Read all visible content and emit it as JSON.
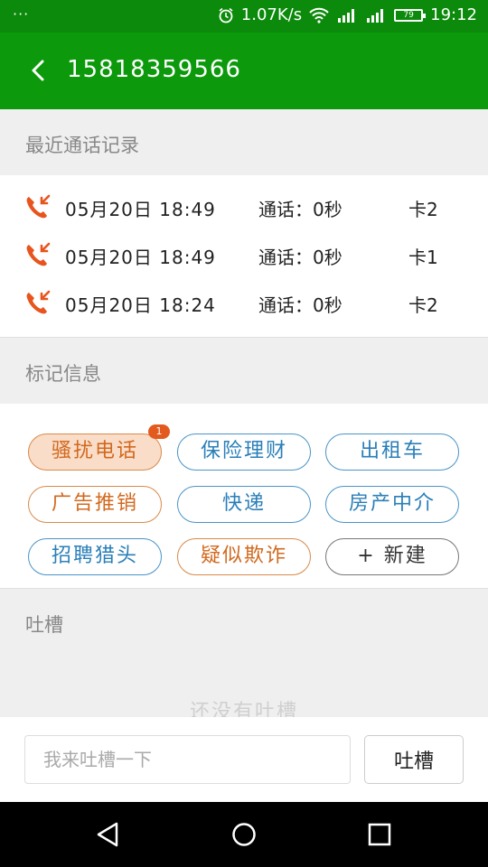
{
  "status_bar": {
    "notification_dots": "···",
    "net_speed": "1.07K/s",
    "battery": "79",
    "time": "19:12"
  },
  "app_bar": {
    "title": "15818359566",
    "back_icon": "chevron-left"
  },
  "recent_calls": {
    "header": "最近通话记录",
    "items": [
      {
        "date": "05月20日",
        "time": "18:49",
        "duration": "通话：0秒",
        "sim": "卡2"
      },
      {
        "date": "05月20日",
        "time": "18:49",
        "duration": "通话：0秒",
        "sim": "卡1"
      },
      {
        "date": "05月20日",
        "time": "18:24",
        "duration": "通话：0秒",
        "sim": "卡2"
      }
    ]
  },
  "tags": {
    "header": "标记信息",
    "items": [
      {
        "label": "骚扰电话",
        "style": "orange",
        "selected": true,
        "count": "1"
      },
      {
        "label": "保险理财",
        "style": "blue"
      },
      {
        "label": "出租车",
        "style": "blue"
      },
      {
        "label": "广告推销",
        "style": "orange"
      },
      {
        "label": "快递",
        "style": "blue"
      },
      {
        "label": "房产中介",
        "style": "blue"
      },
      {
        "label": "招聘猎头",
        "style": "blue"
      },
      {
        "label": "疑似欺诈",
        "style": "orange"
      },
      {
        "label": "+  新建",
        "style": "gray"
      }
    ]
  },
  "comments": {
    "header": "吐槽",
    "empty_text": "还没有吐槽",
    "input_placeholder": "我来吐槽一下",
    "input_value": "",
    "submit_label": "吐槽"
  },
  "colors": {
    "status_bar": "#0b8a0b",
    "app_bar": "#0c9a0c",
    "call_icon": "#e8541e",
    "orange_tag": "#d2691e",
    "blue_tag": "#2a7fb8"
  }
}
